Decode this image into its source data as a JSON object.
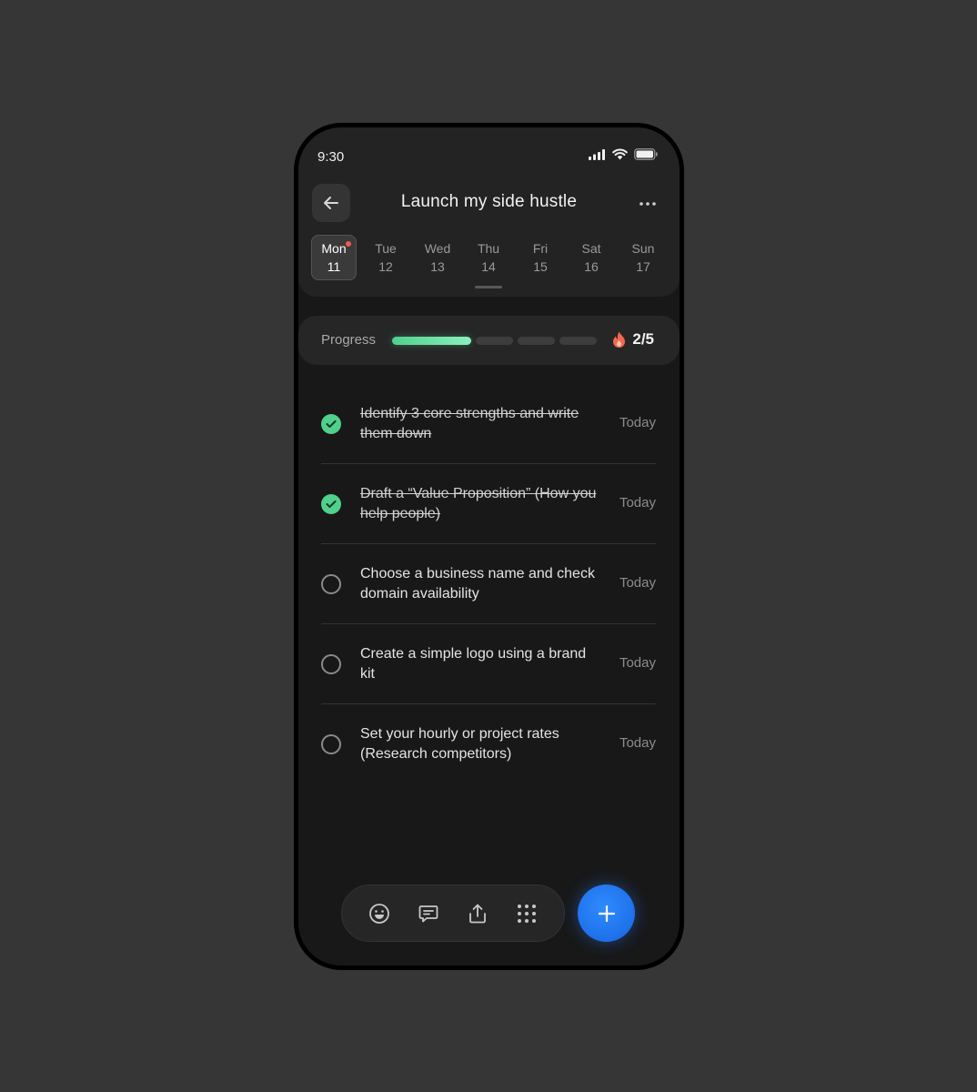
{
  "status_bar": {
    "time": "9:30"
  },
  "header": {
    "title": "Launch my side hustle"
  },
  "week": [
    {
      "name": "Mon",
      "num": "11",
      "active": true,
      "has_dot": true
    },
    {
      "name": "Tue",
      "num": "12"
    },
    {
      "name": "Wed",
      "num": "13"
    },
    {
      "name": "Thu",
      "num": "14"
    },
    {
      "name": "Fri",
      "num": "15"
    },
    {
      "name": "Sat",
      "num": "16"
    },
    {
      "name": "Sun",
      "num": "17"
    }
  ],
  "progress": {
    "label": "Progress",
    "completed": 2,
    "total": 5,
    "count_text": "2/5",
    "fill_fraction": 0.4
  },
  "tasks": [
    {
      "text": "Identify 3 core strengths and write them down",
      "due": "Today",
      "done": true
    },
    {
      "text": "Draft a “Value Proposition” (How you help people)",
      "due": "Today",
      "done": true
    },
    {
      "text": "Choose a business name and check domain availability",
      "due": "Today",
      "done": false
    },
    {
      "text": "Create a simple logo using a brand kit",
      "due": "Today",
      "done": false
    },
    {
      "text": "Set your hourly or project rates (Research competitors)",
      "due": "Today",
      "done": false
    }
  ],
  "toolbar": {
    "icons": [
      "emoji-icon",
      "comment-icon",
      "share-icon",
      "grid-icon"
    ]
  },
  "colors": {
    "accent_green": "#4fd08c",
    "fab_blue": "#1f74f0",
    "notification_dot": "#ee5a4f"
  }
}
